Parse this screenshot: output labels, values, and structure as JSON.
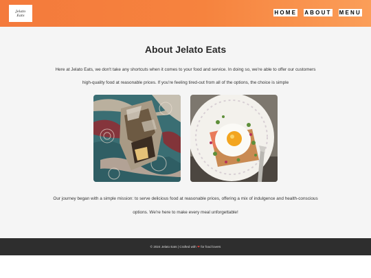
{
  "header": {
    "logo_text": "Jelato\nEats",
    "nav": [
      "HOME",
      "ABOUT",
      "MENU"
    ]
  },
  "about": {
    "title": "About Jelato Eats",
    "intro_line1": "Here at Jelato Eats, we don't take any shortcuts when it comes to your food and service. In doing so, we're able to offer our customers",
    "intro_line2": "high-quality food at reasonable prices. If you're feeling tired-out from all of the options, the choice is simple",
    "journey_line1": "Our journey began with a simple mission: to serve delicious food at reasonable prices, offering a mix of indulgence and health-conscious",
    "journey_line2": "options. We're here to make every meal unforgettable!"
  },
  "footer": {
    "text_before": "© 2024 Jelato Eats | Crafted with",
    "text_after": "for food lovers"
  },
  "colors": {
    "header_gradient_start": "#f47a3c",
    "header_gradient_end": "#fb9e59",
    "footer_bg": "#2e2e2e",
    "main_bg": "#f5f5f5",
    "heart": "#e0413b"
  },
  "icons": [
    "heart-icon"
  ]
}
